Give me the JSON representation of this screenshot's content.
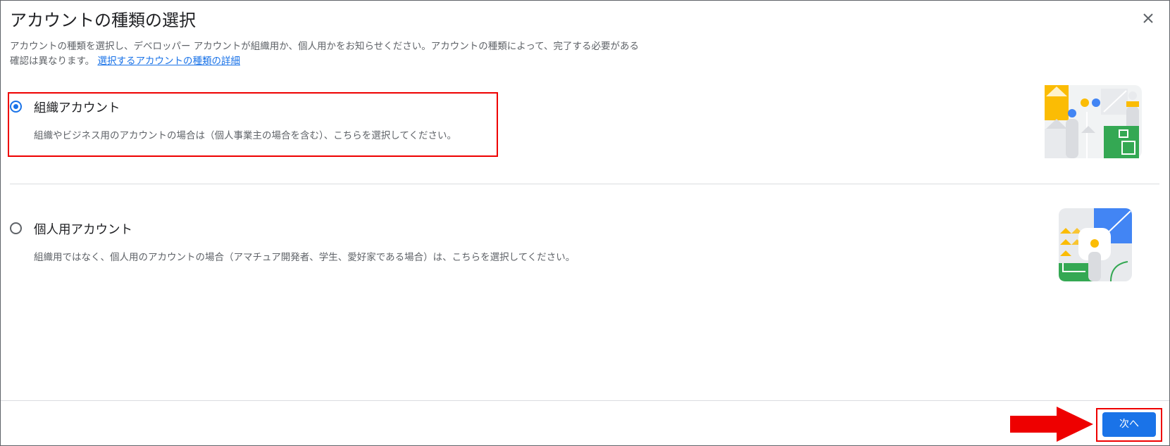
{
  "dialog": {
    "title": "アカウントの種類の選択",
    "description": "アカウントの種類を選択し、デベロッパー アカウントが組織用か、個人用かをお知らせください。アカウントの種類によって、完了する必要がある確認は異なります。",
    "link_text": "選択するアカウントの種類の詳細",
    "close_icon": "close-icon"
  },
  "options": [
    {
      "label": "組織アカウント",
      "sub": "組織やビジネス用のアカウントの場合は（個人事業主の場合を含む）、こちらを選択してください。",
      "selected": true
    },
    {
      "label": "個人用アカウント",
      "sub": "組織用ではなく、個人用のアカウントの場合（アマチュア開発者、学生、愛好家である場合）は、こちらを選択してください。",
      "selected": false
    }
  ],
  "footer": {
    "next_label": "次へ"
  },
  "colors": {
    "accent": "#1a73e8",
    "highlight": "#ee0000",
    "yellow": "#fbbc04",
    "green": "#34a853",
    "grey": "#dadce0"
  }
}
